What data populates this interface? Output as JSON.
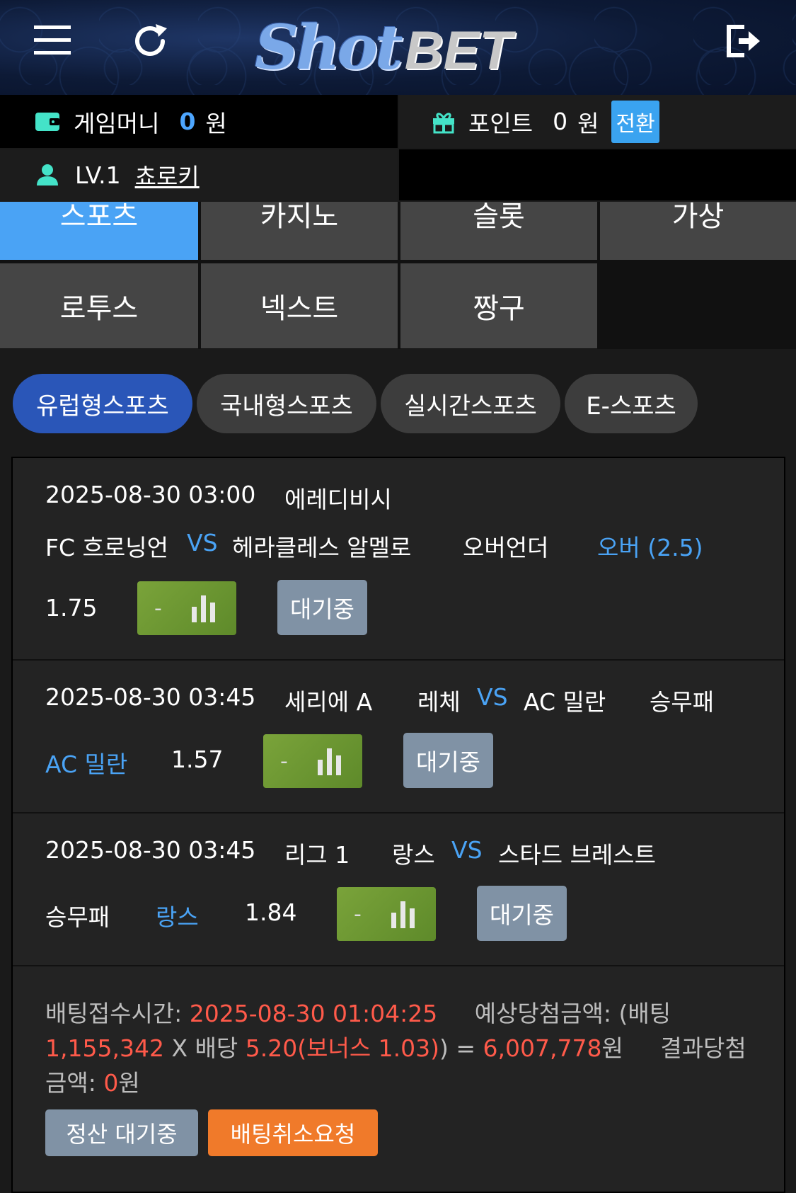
{
  "header": {
    "logo_shot": "Shot",
    "logo_bet": "BET",
    "icons": [
      "menu-icon",
      "refresh-icon",
      "logout-icon"
    ]
  },
  "account": {
    "money_label": "게임머니",
    "money_value": "0",
    "money_unit": "원",
    "point_label": "포인트",
    "point_value": "0",
    "point_unit": "원",
    "convert_label": "전환",
    "level": "LV.1",
    "nickname": "쵸로키"
  },
  "categories": [
    "스포츠",
    "카지노",
    "슬롯",
    "가상",
    "로투스",
    "넥스트",
    "짱구"
  ],
  "sport_tabs": [
    "유럽형스포츠",
    "국내형스포츠",
    "실시간스포츠",
    "E-스포츠"
  ],
  "bets": [
    {
      "datetime": "2025-08-30 03:00",
      "league": "에레디비시",
      "home": "FC 흐로닝언",
      "vs": "VS",
      "away": "헤라클레스 알멜로",
      "market": "오버언더",
      "pick": "오버 (2.5)",
      "odds": "1.75",
      "dash": "-",
      "status": "대기중"
    },
    {
      "datetime": "2025-08-30 03:45",
      "league": "세리에 A",
      "home": "레체",
      "vs": "VS",
      "away": "AC 밀란",
      "market": "승무패",
      "pick": "AC 밀란",
      "odds": "1.57",
      "dash": "-",
      "status": "대기중"
    },
    {
      "datetime": "2025-08-30 03:45",
      "league": "리그 1",
      "home": "랑스",
      "vs": "VS",
      "away": "스타드 브레스트",
      "market": "승무패",
      "pick": "랑스",
      "odds": "1.84",
      "dash": "-",
      "status": "대기중"
    }
  ],
  "summary": {
    "accept_label": "배팅접수시간: ",
    "accept_time": "2025-08-30 01:04:25",
    "expected_label": "예상당첨금액: (배팅 ",
    "stake": "1,155,342",
    "times": " X 배당 ",
    "total_odds": "5.20(보너스 1.03)",
    "equals": ") = ",
    "expected_amount": "6,007,778",
    "won": "원",
    "result_label": "결과당첨금액: ",
    "result_amount": "0",
    "result_unit": "원"
  },
  "actions": {
    "settle_pending": "정산 대기중",
    "cancel_request": "배팅취소요청"
  },
  "colors": {
    "accent_blue": "#4aa3f5",
    "active_tab": "#2a56b8",
    "amount_red": "#ff5a4a",
    "chart_green": "#6e9a32",
    "status_grey": "#8092a5",
    "cancel_orange": "#f07a2a"
  }
}
